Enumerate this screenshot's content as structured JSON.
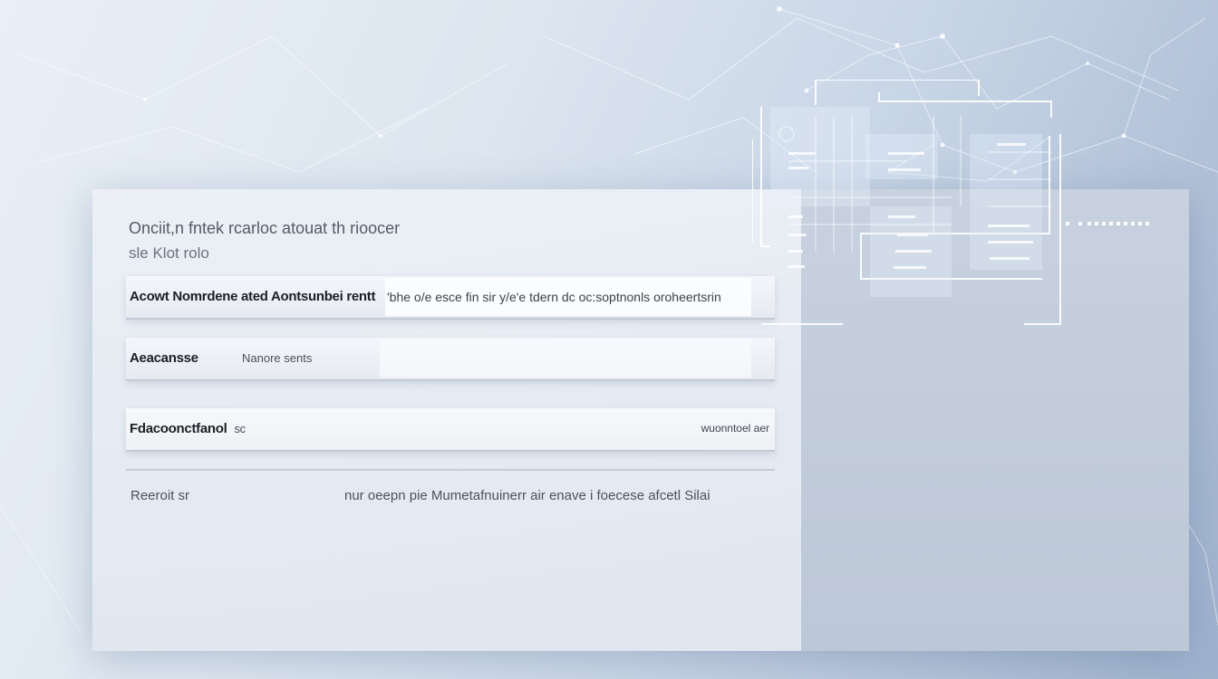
{
  "colors": {
    "panel": "#e6ebf2",
    "panel_right": "#c3cddb",
    "text_dark": "#1c1f24",
    "text_muted": "#555c66",
    "schematic_line": "#ffffff",
    "background_accent": "#9fb2cd"
  },
  "header": {
    "line1": "Onciit,n fntek rcarloc atouat th rioocer",
    "line2": "sle Klot rolo"
  },
  "fields": [
    {
      "label": "Acowt Nomrdene ated Aontsunbei rentt",
      "value": "'bhe o/e esce fin sir y/e'e tdern dc oc:soptnonls oroheertsrin"
    },
    {
      "label": "Aeacansse",
      "value": "Nanore sents"
    },
    {
      "label": "Fdacoonctfanol",
      "label_suffix": "sc",
      "value": "wuonntoel aer"
    }
  ],
  "result": {
    "label": "Reeroit sr",
    "value": "nur oeepn pie Mumetafnuinerr air enave i foecese afcetl Silai"
  },
  "icons": {
    "background": "network-lines-icon",
    "schematic": "circuit-schematic-icon",
    "dots": "dots-indicator-icon"
  }
}
